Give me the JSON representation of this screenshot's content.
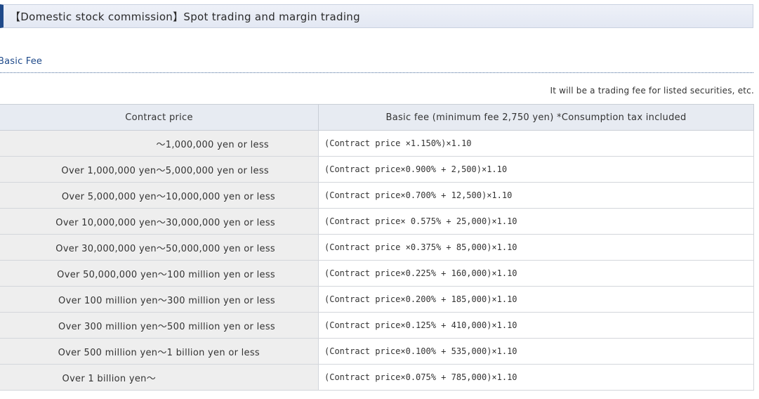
{
  "section": {
    "title": "【Domestic stock commission】Spot trading and margin trading"
  },
  "subheading": "Basic Fee",
  "note": "It will be a trading fee for listed securities, etc.",
  "table": {
    "headers": {
      "price": "Contract price",
      "fee": "Basic fee (minimum fee 2,750 yen) *Consumption tax included"
    },
    "rows": [
      {
        "price": "～1,000,000 yen or less",
        "fee": "(Contract price ×1.150%)×1.10"
      },
      {
        "price": "Over 1,000,000 yen～5,000,000 yen or less",
        "fee": "(Contract price×0.900% + 2,500)×1.10"
      },
      {
        "price": "Over 5,000,000 yen～10,000,000 yen or less",
        "fee": "(Contract price×0.700% + 12,500)×1.10"
      },
      {
        "price": "Over 10,000,000 yen～30,000,000 yen or less",
        "fee": "(Contract price× 0.575% + 25,000)×1.10"
      },
      {
        "price": "Over 30,000,000 yen～50,000,000 yen or less",
        "fee": "(Contract price ×0.375% + 85,000)×1.10"
      },
      {
        "price": "Over 50,000,000 yen～100 million yen or less",
        "fee": "(Contract price×0.225% + 160,000)×1.10"
      },
      {
        "price": "Over 100 million yen～300 million yen or less",
        "fee": "(Contract price×0.200% + 185,000)×1.10"
      },
      {
        "price": "Over 300 million yen～500 million yen or less",
        "fee": "(Contract price×0.125% + 410,000)×1.10"
      },
      {
        "price": "Over 500 million yen～1 billion yen or less",
        "fee": "(Contract price×0.100% + 535,000)×1.10"
      },
      {
        "price": "Over 1 billion yen～",
        "fee": "(Contract price×0.075% + 785,000)×1.10"
      }
    ]
  },
  "colors": {
    "accent": "#1f4a8a",
    "header_bg": "#e7ebf2",
    "price_cell_bg": "#eeeeee"
  }
}
